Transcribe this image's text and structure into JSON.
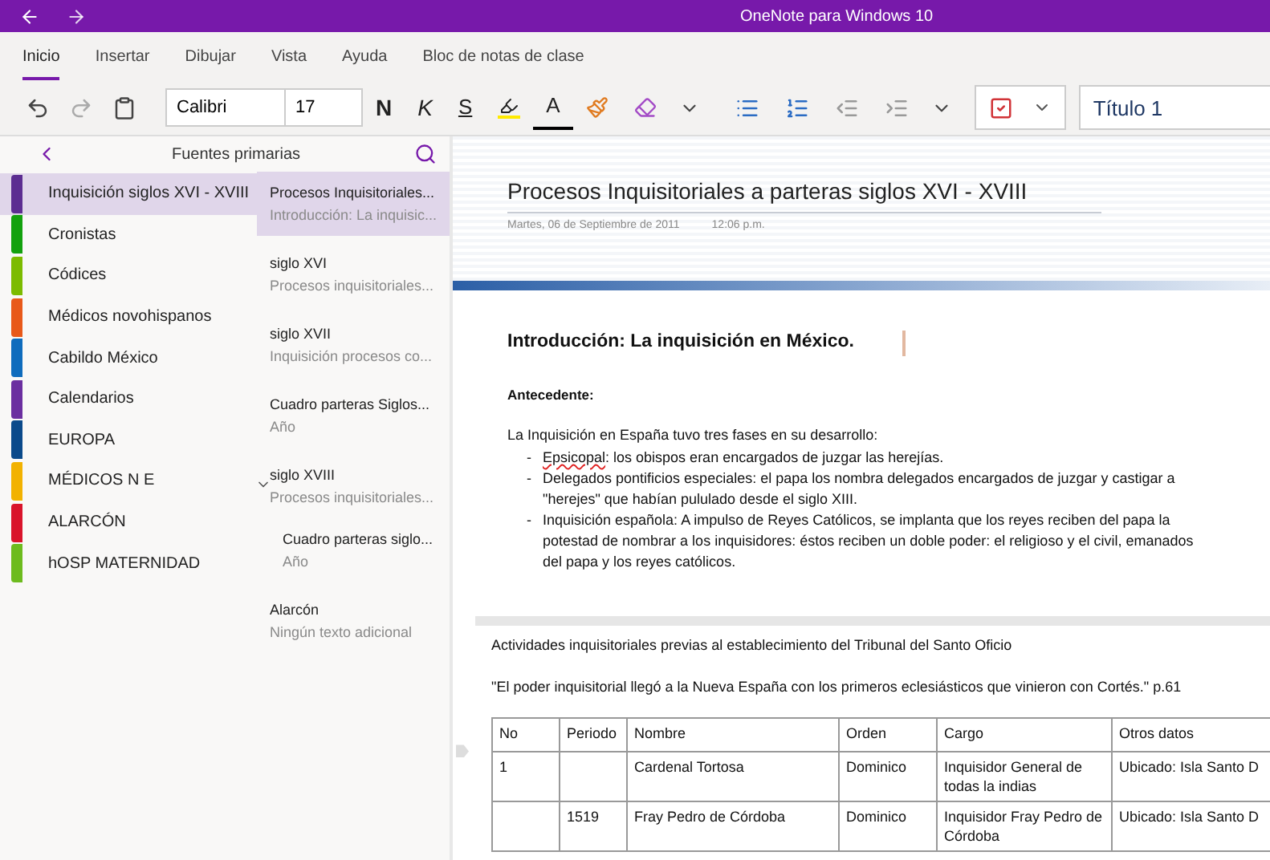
{
  "window": {
    "title": "OneNote para Windows 10"
  },
  "ribbon_tabs": [
    {
      "label": "Inicio",
      "selected": true
    },
    {
      "label": "Insertar",
      "selected": false
    },
    {
      "label": "Dibujar",
      "selected": false
    },
    {
      "label": "Vista",
      "selected": false
    },
    {
      "label": "Ayuda",
      "selected": false
    },
    {
      "label": "Bloc de notas de clase",
      "selected": false
    }
  ],
  "toolbar": [
    {
      "kind": "undo"
    },
    {
      "kind": "redo"
    },
    {
      "kind": "clipboard"
    },
    {
      "kind": "sep"
    },
    {
      "kind": "font",
      "value": "Calibri"
    },
    {
      "kind": "size",
      "value": "17"
    },
    {
      "kind": "bold",
      "label": "N"
    },
    {
      "kind": "italic",
      "label": "K"
    },
    {
      "kind": "underline",
      "label": "S"
    },
    {
      "kind": "highlight"
    },
    {
      "kind": "fontcolor",
      "label": "A"
    },
    {
      "kind": "painter"
    },
    {
      "kind": "clear"
    },
    {
      "kind": "chevron"
    },
    {
      "kind": "sep"
    },
    {
      "kind": "bullets"
    },
    {
      "kind": "numbering"
    },
    {
      "kind": "outdent"
    },
    {
      "kind": "indent"
    },
    {
      "kind": "chevron"
    },
    {
      "kind": "sep"
    },
    {
      "kind": "tag"
    },
    {
      "kind": "sep"
    },
    {
      "kind": "style",
      "value": "Título 1"
    }
  ],
  "notebook": {
    "title": "Fuentes primarias"
  },
  "sections": [
    {
      "label": "Inquisición siglos XVI - XVIII",
      "color": "#5c2d91",
      "selected": true
    },
    {
      "label": "Cronistas",
      "color": "#13a10e",
      "selected": false
    },
    {
      "label": "Códices",
      "color": "#7cbb00",
      "selected": false
    },
    {
      "label": "Médicos novohispanos",
      "color": "#e8591a",
      "selected": false
    },
    {
      "label": "Cabildo México",
      "color": "#0f6cbd",
      "selected": false
    },
    {
      "label": "Calendarios",
      "color": "#6b2fa0",
      "selected": false
    },
    {
      "label": "EUROPA",
      "color": "#0b4a8b",
      "selected": false
    },
    {
      "label": "MÉDICOS N E",
      "color": "#f2b200",
      "selected": false
    },
    {
      "label": "ALARCÓN",
      "color": "#d9142b",
      "selected": false
    },
    {
      "label": "hOSP MATERNIDAD",
      "color": "#6dbb1e",
      "selected": false
    }
  ],
  "pages": [
    {
      "title": "Procesos Inquisitoriales...",
      "preview": "Introducción: La inquisic...",
      "selected": true
    },
    {
      "title": "siglo XVI",
      "preview": "Procesos inquisitoriales...",
      "selected": false
    },
    {
      "title": "siglo XVII",
      "preview": "Inquisición procesos co...",
      "selected": false
    },
    {
      "title": "Cuadro parteras Siglos...",
      "preview": "Año",
      "selected": false
    },
    {
      "title": "siglo XVIII",
      "preview": "Procesos inquisitoriales...",
      "selected": false,
      "expanded": true,
      "children": [
        {
          "title": "Cuadro parteras siglo...",
          "preview": "Año",
          "selected": false
        }
      ]
    },
    {
      "title": "Alarcón",
      "preview": "Ningún texto adicional",
      "selected": false
    }
  ],
  "page": {
    "title": "Procesos Inquisitoriales a parteras siglos XVI - XVIII",
    "date": "Martes, 06 de Septiembre de 2011",
    "time": "12:06 p.m.",
    "heading": "Introducción: La inquisición en México.",
    "subheading": "Antecedente:",
    "intro": "La Inquisición en España tuvo tres fases en su desarrollo:",
    "bullets": [
      {
        "marker": "-",
        "misspelled": "Epsicopal",
        "text": ": los obispos eran encargados de juzgar las herejías."
      },
      {
        "marker": "-",
        "text": "Delegados pontificios especiales: el papa los nombra delegados encargados de juzgar y castigar a \"herejes\" que habían pululado desde el siglo XIII."
      },
      {
        "marker": "-",
        "text": "Inquisición española: A impulso de Reyes Católicos, se implanta que los reyes reciben del papa la potestad de  nombrar a los inquisidores: éstos reciben un doble poder: el religioso y el civil, emanados del papa y los reyes católicos."
      }
    ],
    "caption": "Actividades inquisitoriales previas al establecimiento del Tribunal del Santo Oficio",
    "quote": "\"El poder inquisitorial llegó a la Nueva España con los primeros eclesiásticos que vinieron con Cortés.\" p.61",
    "table": {
      "columns": [
        "No",
        "Periodo",
        "Nombre",
        "Orden",
        "Cargo",
        "Otros datos"
      ],
      "rows": [
        [
          "1",
          "",
          "Cardenal Tortosa",
          "Dominico",
          "Inquisidor General de todas la indias",
          "Ubicado: Isla Santo D"
        ],
        [
          "",
          "1519",
          "Fray Pedro de Córdoba",
          "Dominico",
          "Inquisidor Fray Pedro de Córdoba",
          "Ubicado: Isla Santo D"
        ]
      ]
    }
  }
}
